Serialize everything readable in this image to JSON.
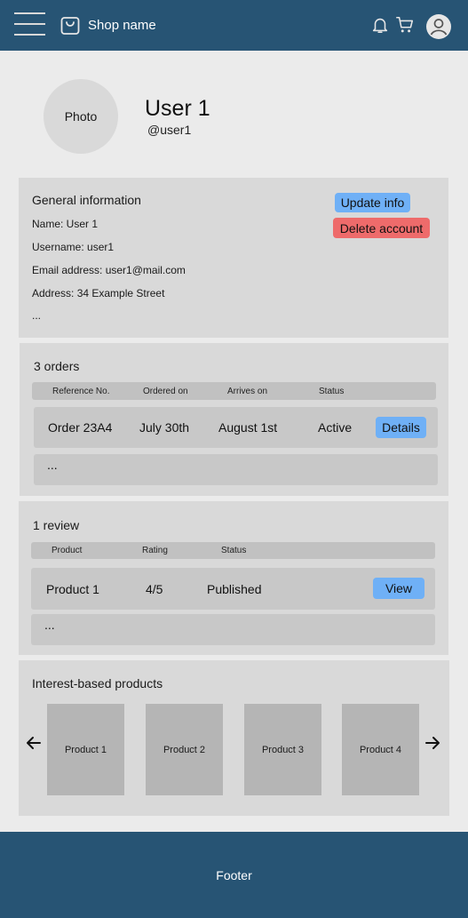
{
  "header": {
    "shop_name": "Shop name",
    "icons": [
      "menu-icon",
      "shopping-bag-icon",
      "bell-icon",
      "cart-icon",
      "user-avatar-icon"
    ]
  },
  "profile": {
    "photo_label": "Photo",
    "name": "User 1",
    "handle": "@user1"
  },
  "general_info": {
    "title": "General information",
    "lines": [
      "Name: User 1",
      "Username: user1",
      "Email address: user1@mail.com",
      "Address: 34 Example Street",
      "..."
    ],
    "update_button": "Update info",
    "delete_button": "Delete account"
  },
  "orders": {
    "title": "3 orders",
    "columns": [
      "Reference No.",
      "Ordered on",
      "Arrives on",
      "Status"
    ],
    "rows": [
      {
        "reference": "Order 23A4",
        "ordered_on": "July 30th",
        "arrives_on": "August 1st",
        "status": "Active",
        "action": "Details"
      }
    ],
    "more": "..."
  },
  "reviews": {
    "title": "1 review",
    "columns": [
      "Product",
      "Rating",
      "Status"
    ],
    "rows": [
      {
        "product": "Product 1",
        "rating": "4/5",
        "status": "Published",
        "action": "View"
      }
    ],
    "more": "..."
  },
  "interest_products": {
    "title": "Interest-based products",
    "items": [
      "Product 1",
      "Product 2",
      "Product 3",
      "Product 4"
    ]
  },
  "footer": {
    "label": "Footer"
  },
  "colors": {
    "nav_bg": "#275474",
    "page_bg": "#ebebeb",
    "card_bg": "#d9d9d9",
    "primary_button": "#6fb0f6",
    "danger_button": "#ee6b6b"
  }
}
